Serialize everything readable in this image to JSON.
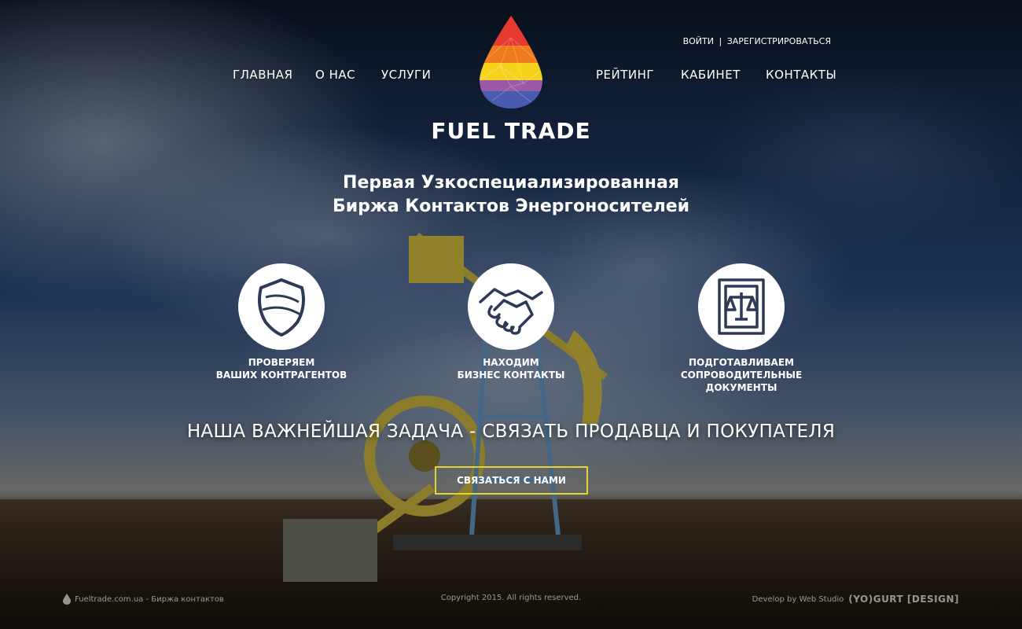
{
  "header": {
    "login_label": "ВОЙТИ",
    "separator": "|",
    "register_label": "ЗАРЕГИСТРИРОВАТЬСЯ",
    "nav_left": [
      "ГЛАВНАЯ",
      "О НАС",
      "УСЛУГИ"
    ],
    "nav_right": [
      "РЕЙТИНГ",
      "КАБИНЕТ",
      "КОНТАКТЫ"
    ],
    "brand": "FUEL TRADE"
  },
  "hero": {
    "headline_line1": "Первая Узкоспециализированная",
    "headline_line2": "Биржа Контактов Энергоносителей",
    "features": [
      {
        "line1": "ПРОВЕРЯЕМ",
        "line2": "ВАШИХ КОНТРАГЕНТОВ",
        "icon": "shield-icon"
      },
      {
        "line1": "НАХОДИМ",
        "line2": "БИЗНЕС КОНТАКТЫ",
        "icon": "handshake-icon"
      },
      {
        "line1": "ПОДГОТАВЛИВАЕМ",
        "line2": "СОПРОВОДИТЕЛЬНЫЕ ДОКУМЕНТЫ",
        "icon": "scales-document-icon"
      }
    ],
    "tagline": "НАША ВАЖНЕЙШАЯ ЗАДАЧА - СВЯЗАТЬ ПРОДАВЦА И ПОКУПАТЕЛЯ",
    "cta_label": "СВЯЗАТЬСЯ С НАМИ"
  },
  "footer": {
    "left": "Fueltrade.com.ua - Биржа контактов",
    "center": "Copyright 2015. All rights reserved.",
    "right_prefix": "Develop by Web Studio",
    "right_brand": "(YO)GURT [DESIGN]"
  },
  "colors": {
    "cta_border": "#e4d230",
    "icon_stroke": "#2e3a55"
  }
}
